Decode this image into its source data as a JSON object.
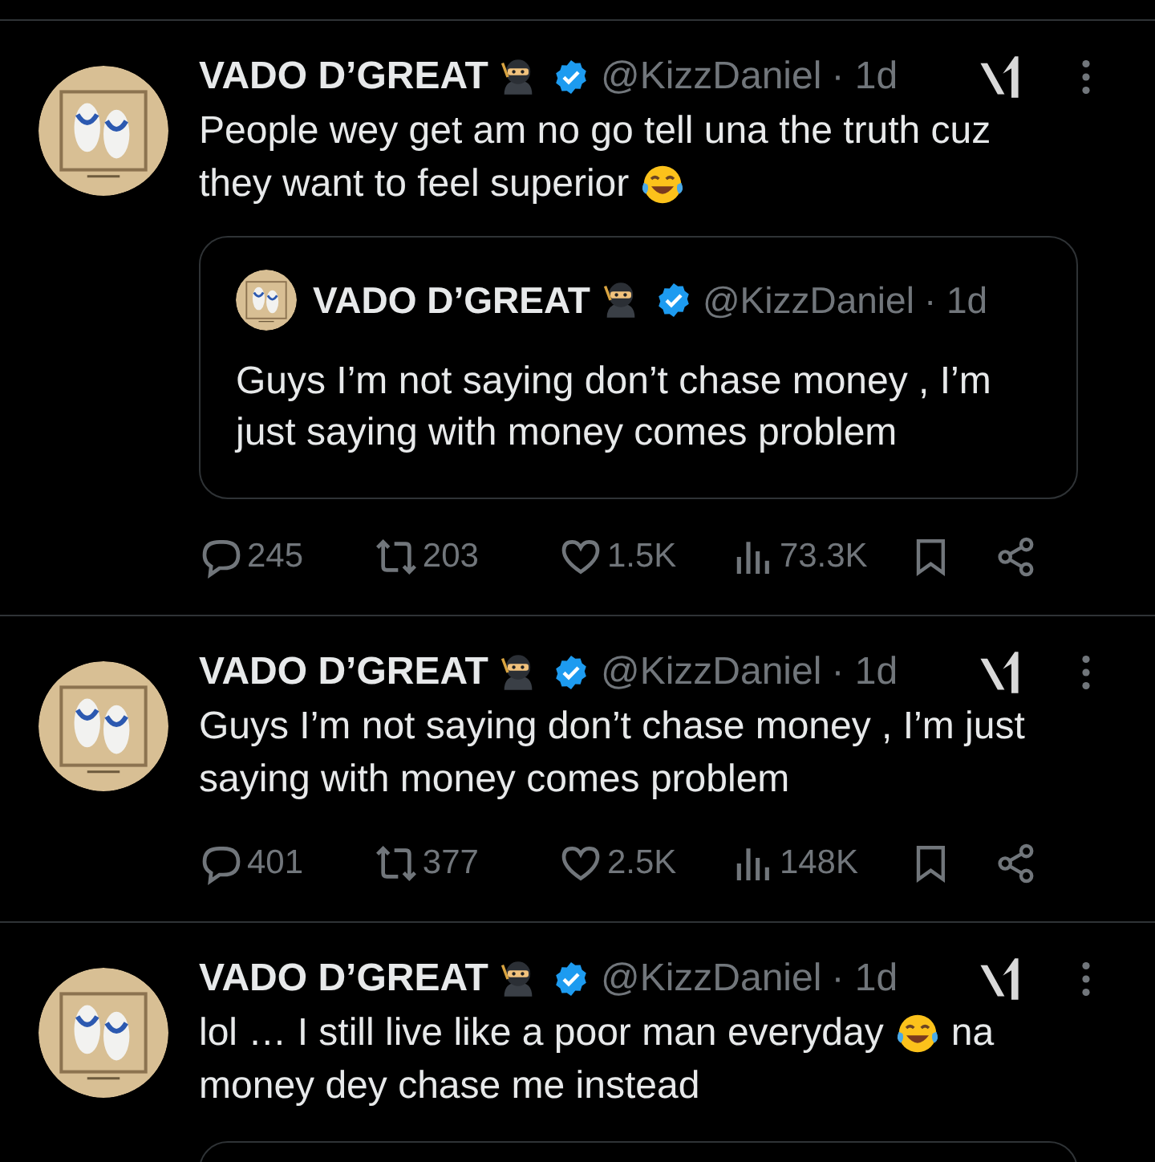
{
  "tweets": [
    {
      "name": "VADO D’GREAT",
      "handle": "@KizzDaniel",
      "time": "· 1d",
      "lines": [
        [
          {
            "kind": "text",
            "text": "People wey get am no go tell una the truth cuz"
          }
        ],
        [
          {
            "kind": "text",
            "text": "they want to feel superior"
          },
          {
            "kind": "emoji"
          }
        ]
      ],
      "quote": {
        "kind": "full",
        "name": "VADO D’GREAT",
        "handle": "@KizzDaniel",
        "time": "· 1d",
        "text": "Guys I’m not saying don’t chase money , I’m just saying with money comes problem"
      },
      "stats": {
        "replies": "245",
        "reposts": "203",
        "likes": "1.5K",
        "views": "73.3K"
      }
    },
    {
      "name": "VADO D’GREAT",
      "handle": "@KizzDaniel",
      "time": "· 1d",
      "lines": [
        [
          {
            "kind": "text",
            "text": "Guys I’m not saying don’t chase money , I’m just"
          }
        ],
        [
          {
            "kind": "text",
            "text": "saying with money comes problem"
          }
        ]
      ],
      "stats": {
        "replies": "401",
        "reposts": "377",
        "likes": "2.5K",
        "views": "148K"
      }
    },
    {
      "name": "VADO D’GREAT",
      "handle": "@KizzDaniel",
      "time": "· 1d",
      "lines": [
        [
          {
            "kind": "text",
            "text": "lol … I still live like a poor man everyday"
          },
          {
            "kind": "emoji"
          },
          {
            "kind": "text",
            "text": "na"
          }
        ],
        [
          {
            "kind": "text",
            "text": "money dey chase me instead"
          }
        ]
      ],
      "quote": {
        "kind": "cut"
      }
    }
  ]
}
